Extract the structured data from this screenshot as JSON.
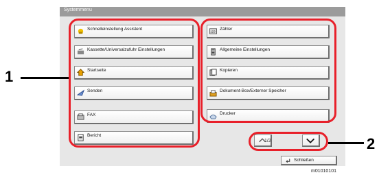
{
  "window": {
    "title": "Systemmenu"
  },
  "left_column": [
    {
      "label": "Schnelleinstellung Assistent",
      "icon": "wizard-icon"
    },
    {
      "label": "Kassette/Universalzufuhr Einstellungen",
      "icon": "cassette-icon"
    },
    {
      "label": "Startseite",
      "icon": "home-icon"
    },
    {
      "label": "Senden",
      "icon": "send-icon"
    },
    {
      "label": "FAX",
      "icon": "fax-icon"
    },
    {
      "label": "Bericht",
      "icon": "report-icon"
    }
  ],
  "right_column": [
    {
      "label": "Zähler",
      "icon": "counter-icon"
    },
    {
      "label": "Allgemeine Einstellungen",
      "icon": "settings-icon"
    },
    {
      "label": "Kopieren",
      "icon": "copy-icon"
    },
    {
      "label": "Dokument-Box/Externer Speicher",
      "icon": "document-box-icon"
    },
    {
      "label": "Drucker",
      "icon": "printer-icon"
    }
  ],
  "pagination": {
    "page": "1/2"
  },
  "close_button": {
    "label": "Schließen"
  },
  "callouts": {
    "one": "1",
    "two": "2"
  },
  "footer": {
    "code": "m01010101"
  }
}
